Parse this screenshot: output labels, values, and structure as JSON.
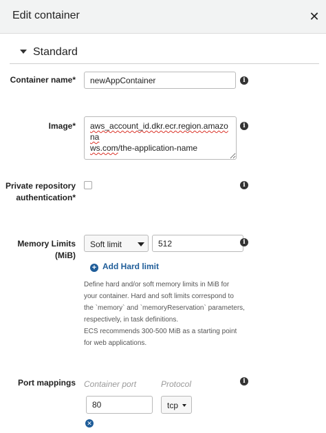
{
  "header": {
    "title": "Edit container",
    "close_icon": "close-icon"
  },
  "section": {
    "title": "Standard"
  },
  "fields": {
    "container_name": {
      "label": "Container name*",
      "value": "newAppContainer"
    },
    "image": {
      "label": "Image*",
      "value_line1": "aws_account_id.dkr.ecr.region.amazona",
      "value_line2_underlined": "ws.com",
      "value_line2_rest": "/the-application-name"
    },
    "private_repo": {
      "label": "Private repository authentication*",
      "checked": false
    },
    "memory": {
      "label": "Memory Limits (MiB)",
      "limit_type": "Soft limit",
      "value": "512",
      "add_hard_limit": "Add Hard limit",
      "help_lines": [
        "Define hard and/or soft memory limits in MiB for",
        "your container. Hard and soft limits correspond to",
        "the `memory` and `memoryReservation` parameters,",
        "respectively, in task definitions.",
        "ECS recommends 300-500 MiB as a starting point",
        "for web applications."
      ]
    },
    "port_mappings": {
      "label": "Port mappings",
      "container_port_label": "Container port",
      "protocol_label": "Protocol",
      "container_port_value": "80",
      "protocol_value": "tcp"
    }
  },
  "icons": {
    "info": "info-icon",
    "add": "plus-circle-icon",
    "remove": "remove-icon"
  },
  "colors": {
    "link": "#1f5d99",
    "header_bg": "#f2f3f3"
  }
}
